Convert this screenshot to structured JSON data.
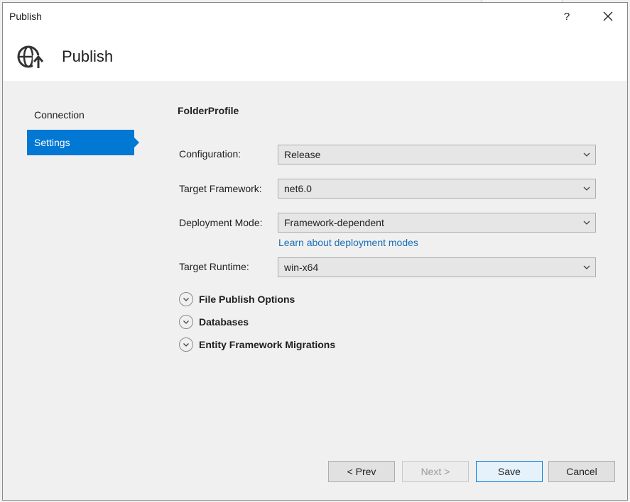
{
  "window": {
    "title": "Publish",
    "help_label": "?",
    "close_label": "✕"
  },
  "header": {
    "title": "Publish",
    "icon": "globe-upload-icon"
  },
  "nav": {
    "items": [
      {
        "label": "Connection",
        "active": false
      },
      {
        "label": "Settings",
        "active": true
      }
    ]
  },
  "profile": {
    "name": "FolderProfile"
  },
  "form": {
    "configuration": {
      "label": "Configuration:",
      "value": "Release"
    },
    "target_framework": {
      "label": "Target Framework:",
      "value": "net6.0"
    },
    "deployment_mode": {
      "label": "Deployment Mode:",
      "value": "Framework-dependent"
    },
    "deployment_link": "Learn about deployment modes",
    "target_runtime": {
      "label": "Target Runtime:",
      "value": "win-x64"
    }
  },
  "sections": [
    {
      "label": "File Publish Options"
    },
    {
      "label": "Databases"
    },
    {
      "label": "Entity Framework Migrations"
    }
  ],
  "footer": {
    "prev_label": "< Prev",
    "next_label": "Next >",
    "save_label": "Save",
    "cancel_label": "Cancel"
  },
  "colors": {
    "accent": "#0078d4",
    "link": "#1a6fb5"
  }
}
